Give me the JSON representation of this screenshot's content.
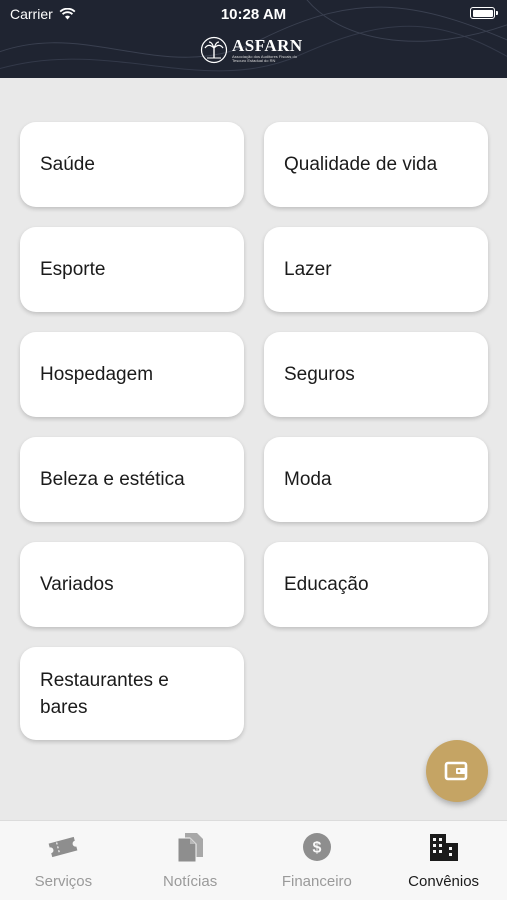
{
  "status_bar": {
    "carrier": "Carrier",
    "time": "10:28 AM"
  },
  "header": {
    "logo_name": "ASFARN",
    "logo_subtitle": "Associação dos Auditores Fiscais do Tesouro Estadual do RN"
  },
  "categories": [
    {
      "label": "Saúde"
    },
    {
      "label": "Qualidade de vida"
    },
    {
      "label": "Esporte"
    },
    {
      "label": "Lazer"
    },
    {
      "label": "Hospedagem"
    },
    {
      "label": "Seguros"
    },
    {
      "label": "Beleza e estética"
    },
    {
      "label": "Moda"
    },
    {
      "label": "Variados"
    },
    {
      "label": "Educação"
    },
    {
      "label": "Restaurantes e bares"
    }
  ],
  "fab": {
    "icon": "wallet-icon",
    "color": "#c5a464"
  },
  "tabs": [
    {
      "label": "Serviços",
      "icon": "ticket-icon",
      "active": false
    },
    {
      "label": "Notícias",
      "icon": "document-icon",
      "active": false
    },
    {
      "label": "Financeiro",
      "icon": "dollar-icon",
      "active": false
    },
    {
      "label": "Convênios",
      "icon": "building-icon",
      "active": true
    }
  ],
  "colors": {
    "header_bg": "#1f2431",
    "accent": "#c5a464",
    "background": "#e9e9e9"
  }
}
